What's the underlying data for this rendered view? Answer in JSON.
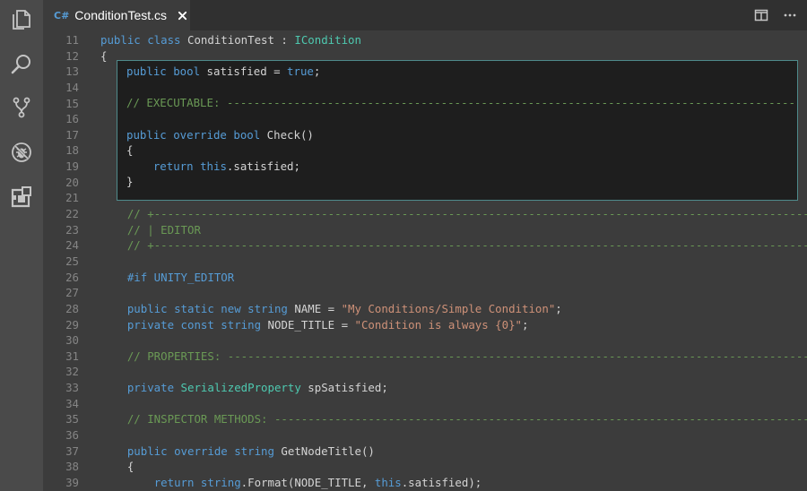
{
  "tab": {
    "lang_badge": "C#",
    "title": "ConditionTest.cs"
  },
  "icons": {
    "activity": [
      "files-icon",
      "search-icon",
      "source-control-icon",
      "debug-icon",
      "extensions-icon"
    ],
    "tab_close": "close-icon",
    "split": "split-editor-icon",
    "more": "more-icon"
  },
  "colors": {
    "keyword": "#569cd6",
    "type": "#4ec9b0",
    "string": "#ce9178",
    "comment": "#6a9955",
    "text": "#d4d4d4",
    "line_number": "#858585"
  },
  "peek_lines": [
    {
      "code": [
        {
          "c": "kw",
          "t": "public "
        },
        {
          "c": "kw",
          "t": "bool"
        },
        {
          "c": "",
          "t": " satisfied = "
        },
        {
          "c": "kw",
          "t": "true"
        },
        {
          "c": "",
          "t": ";"
        }
      ]
    },
    {
      "code": []
    },
    {
      "code": [
        {
          "c": "cm",
          "t": "// EXECUTABLE: ---------------------------------------------------------------------------------------------------------------"
        }
      ]
    },
    {
      "code": []
    },
    {
      "code": [
        {
          "c": "kw",
          "t": "public "
        },
        {
          "c": "kw",
          "t": "override "
        },
        {
          "c": "kw",
          "t": "bool"
        },
        {
          "c": "",
          "t": " Check()"
        }
      ]
    },
    {
      "code": [
        {
          "c": "",
          "t": "{"
        }
      ]
    },
    {
      "code": [
        {
          "c": "",
          "t": "    "
        },
        {
          "c": "kw",
          "t": "return "
        },
        {
          "c": "kw",
          "t": "this"
        },
        {
          "c": "",
          "t": ".satisfied;"
        }
      ]
    },
    {
      "code": [
        {
          "c": "",
          "t": "}"
        }
      ]
    }
  ],
  "lines": [
    {
      "num": "11",
      "code": [
        {
          "c": "kw",
          "t": "public "
        },
        {
          "c": "kw",
          "t": "class"
        },
        {
          "c": "",
          "t": " ConditionTest : "
        },
        {
          "c": "ty",
          "t": "ICondition"
        }
      ]
    },
    {
      "num": "12",
      "code": [
        {
          "c": "",
          "t": "{"
        }
      ]
    },
    {
      "num": "13",
      "code": []
    },
    {
      "num": "14",
      "code": []
    },
    {
      "num": "15",
      "code": []
    },
    {
      "num": "16",
      "code": []
    },
    {
      "num": "17",
      "code": []
    },
    {
      "num": "18",
      "code": []
    },
    {
      "num": "19",
      "code": []
    },
    {
      "num": "20",
      "code": []
    },
    {
      "num": "21",
      "code": []
    },
    {
      "num": "22",
      "code": [
        {
          "c": "",
          "t": "    "
        },
        {
          "c": "cm",
          "t": "// +-------------------------------------------------------------------------------------------------------------------------"
        }
      ]
    },
    {
      "num": "23",
      "code": [
        {
          "c": "",
          "t": "    "
        },
        {
          "c": "cm",
          "t": "// | EDITOR"
        }
      ]
    },
    {
      "num": "24",
      "code": [
        {
          "c": "",
          "t": "    "
        },
        {
          "c": "cm",
          "t": "// +-------------------------------------------------------------------------------------------------------------------------"
        }
      ]
    },
    {
      "num": "25",
      "code": []
    },
    {
      "num": "26",
      "code": [
        {
          "c": "",
          "t": "    "
        },
        {
          "c": "pp",
          "t": "#if UNITY_EDITOR"
        }
      ]
    },
    {
      "num": "27",
      "code": []
    },
    {
      "num": "28",
      "code": [
        {
          "c": "",
          "t": "    "
        },
        {
          "c": "kw",
          "t": "public "
        },
        {
          "c": "kw",
          "t": "static "
        },
        {
          "c": "kw",
          "t": "new "
        },
        {
          "c": "kw",
          "t": "string"
        },
        {
          "c": "",
          "t": " NAME = "
        },
        {
          "c": "str",
          "t": "\"My Conditions/Simple Condition\""
        },
        {
          "c": "",
          "t": ";"
        }
      ]
    },
    {
      "num": "29",
      "code": [
        {
          "c": "",
          "t": "    "
        },
        {
          "c": "kw",
          "t": "private "
        },
        {
          "c": "kw",
          "t": "const "
        },
        {
          "c": "kw",
          "t": "string"
        },
        {
          "c": "",
          "t": " NODE_TITLE = "
        },
        {
          "c": "str",
          "t": "\"Condition is always {0}\""
        },
        {
          "c": "",
          "t": ";"
        }
      ]
    },
    {
      "num": "30",
      "code": []
    },
    {
      "num": "31",
      "code": [
        {
          "c": "",
          "t": "    "
        },
        {
          "c": "cm",
          "t": "// PROPERTIES: ------------------------------------------------------------------------------------------------------------"
        }
      ]
    },
    {
      "num": "32",
      "code": []
    },
    {
      "num": "33",
      "code": [
        {
          "c": "",
          "t": "    "
        },
        {
          "c": "kw",
          "t": "private "
        },
        {
          "c": "ty",
          "t": "SerializedProperty"
        },
        {
          "c": "",
          "t": " spSatisfied;"
        }
      ]
    },
    {
      "num": "34",
      "code": []
    },
    {
      "num": "35",
      "code": [
        {
          "c": "",
          "t": "    "
        },
        {
          "c": "cm",
          "t": "// INSPECTOR METHODS: -----------------------------------------------------------------------------------------------------"
        }
      ]
    },
    {
      "num": "36",
      "code": []
    },
    {
      "num": "37",
      "code": [
        {
          "c": "",
          "t": "    "
        },
        {
          "c": "kw",
          "t": "public "
        },
        {
          "c": "kw",
          "t": "override "
        },
        {
          "c": "kw",
          "t": "string"
        },
        {
          "c": "",
          "t": " GetNodeTitle()"
        }
      ]
    },
    {
      "num": "38",
      "code": [
        {
          "c": "",
          "t": "    {"
        }
      ]
    },
    {
      "num": "39",
      "code": [
        {
          "c": "",
          "t": "        "
        },
        {
          "c": "kw",
          "t": "return "
        },
        {
          "c": "kw",
          "t": "string"
        },
        {
          "c": "",
          "t": ".Format(NODE_TITLE, "
        },
        {
          "c": "kw",
          "t": "this"
        },
        {
          "c": "",
          "t": ".satisfied);"
        }
      ]
    }
  ]
}
